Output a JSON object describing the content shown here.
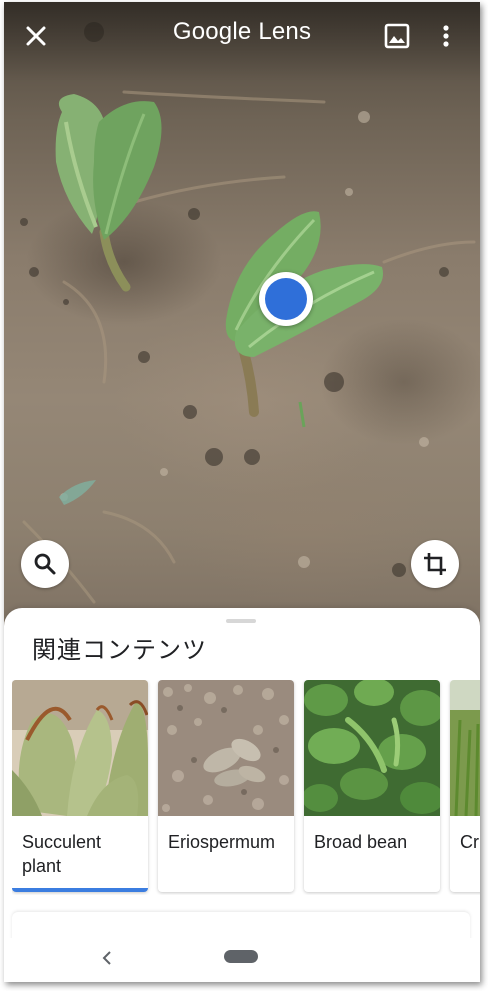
{
  "app": {
    "title_google": "Google",
    "title_lens": "Lens"
  },
  "icons": {
    "close": "close-icon",
    "gallery": "image-gallery-icon",
    "more": "more-vertical-icon",
    "search": "search-icon",
    "crop": "crop-icon",
    "back": "nav-back-icon",
    "home": "nav-home-pill"
  },
  "colors": {
    "accent": "#3b7de0",
    "focus_dot": "#2f6fd9"
  },
  "results": {
    "heading": "関連コンテンツ",
    "selected_index": 0,
    "items": [
      {
        "label": "Succulent plant"
      },
      {
        "label": "Eriospermum"
      },
      {
        "label": "Broad bean"
      },
      {
        "label": "Cr"
      }
    ]
  }
}
